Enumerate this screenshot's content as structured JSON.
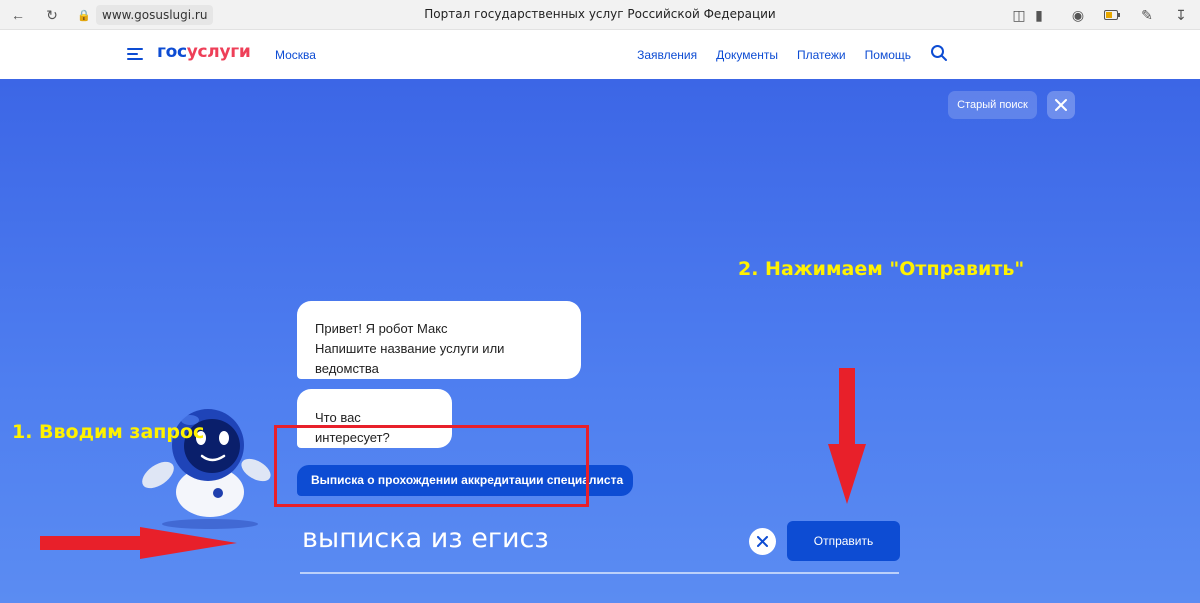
{
  "browser": {
    "url": "www.gosuslugi.ru",
    "title": "Портал государственных услуг Российской Федерации"
  },
  "header": {
    "logo_part1": "гос",
    "logo_part2": "услуги",
    "city": "Москва",
    "nav": [
      "Заявления",
      "Документы",
      "Платежи",
      "Помощь"
    ]
  },
  "main": {
    "old_search_label": "Старый поиск",
    "bot_greeting_line1": "Привет! Я робот Макс",
    "bot_greeting_line2": "Напишите название услуги или ведомства",
    "bot_question": "Что вас интересует?",
    "suggestion": "Выписка о прохождении аккредитации специалиста",
    "query_value": "выписка из егисз",
    "send_label": "Отправить"
  },
  "annotations": {
    "step1": "1. Вводим запрос",
    "step2": "2. Нажимаем \"Отправить\""
  },
  "colors": {
    "brand_blue": "#0d4cd3",
    "brand_red": "#ee3f58",
    "annotation_yellow": "#fff200",
    "annotation_red": "#e8202a"
  }
}
